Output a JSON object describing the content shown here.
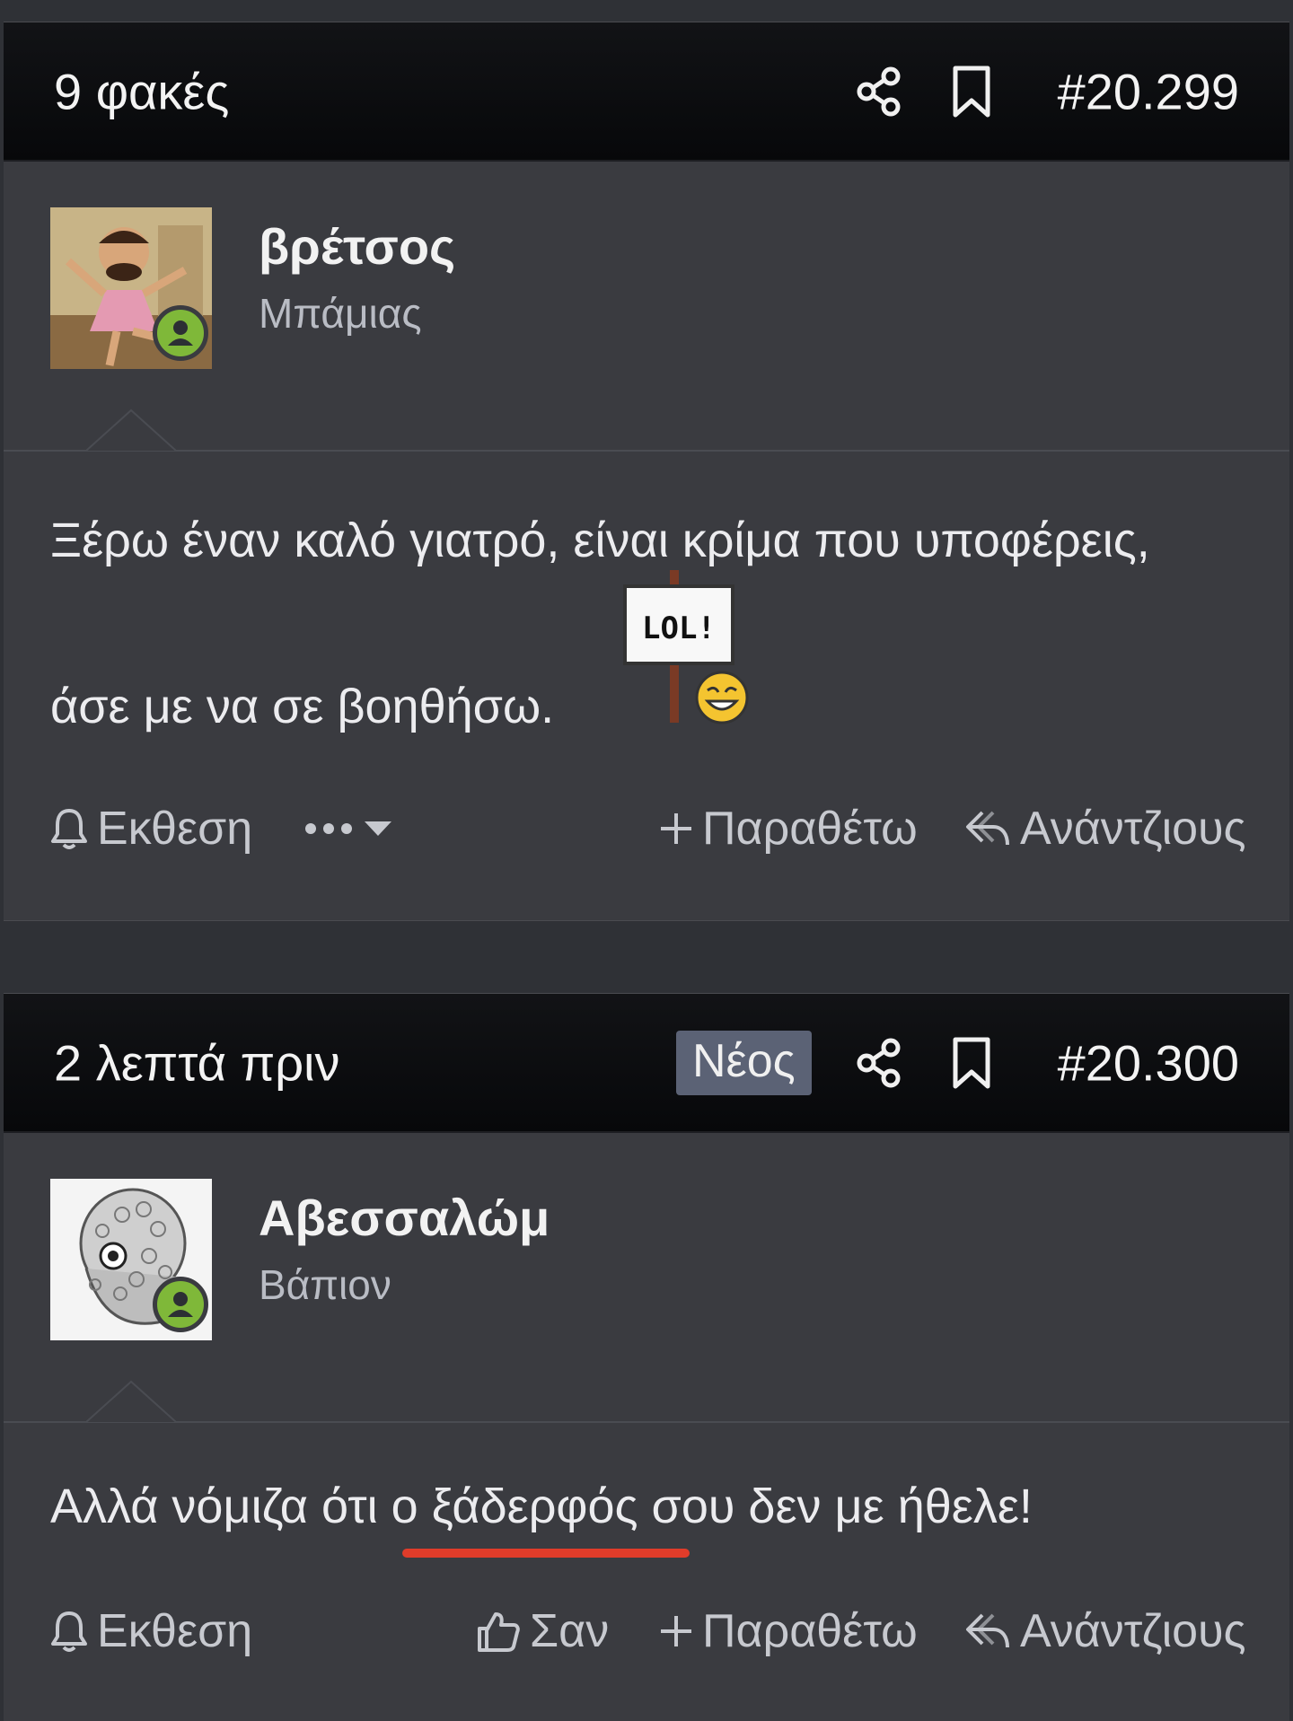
{
  "posts": [
    {
      "time": "9 φακές",
      "number": "#20.299",
      "author": "βρέτσος",
      "rank": "Μπάμιας",
      "text_line1": "Ξέρω έναν καλό γιατρό, είναι κρίμα που υποφέρεις,",
      "text_line2": "άσε με να σε βοηθήσω.",
      "emoji_sign": "LOL!",
      "actions": {
        "report": "Εκθεση",
        "quote": "Παραθέτω",
        "reply": "Ανάντζιους"
      }
    },
    {
      "time": "2 λεπτά πριν",
      "badge": "Νέος",
      "number": "#20.300",
      "author": "Αβεσσαλώμ",
      "rank": "Βάπιον",
      "text_before": "Αλλά νόμιζα ότι ο ",
      "text_marked": "ξάδερφός",
      "text_after": " σου δεν με ήθελε!",
      "actions": {
        "report": "Εκθεση",
        "like": "Σαν",
        "quote": "Παραθέτω",
        "reply": "Ανάντζιους"
      }
    }
  ],
  "icons": [
    "share-icon",
    "bookmark-icon",
    "bell-icon",
    "more-dots-icon",
    "chevron-down-icon",
    "plus-icon",
    "reply-icon",
    "thumbs-up-icon"
  ],
  "colors": {
    "online": "#7fb839",
    "spellcheck": "#e03c2a",
    "badge_bg": "#5b6275"
  }
}
